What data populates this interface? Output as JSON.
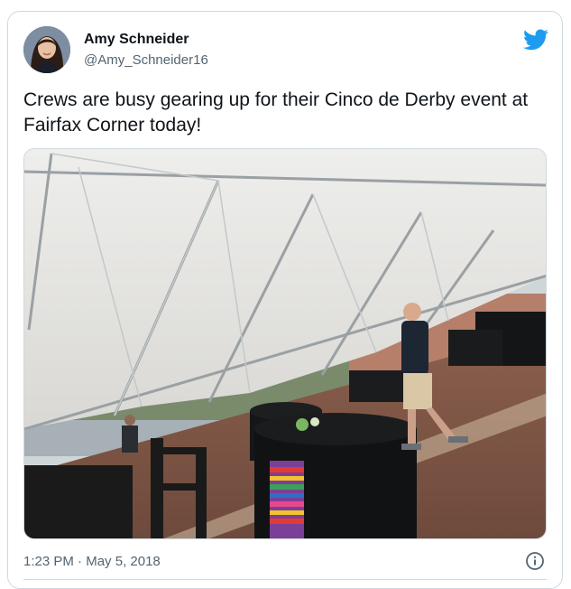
{
  "author": {
    "name": "Amy Schneider",
    "handle": "@Amy_Schneider16",
    "avatar_icon": "profile-photo"
  },
  "tweet": {
    "text": "Crews are busy gearing up for their Cinco de Derby event at Fairfax Corner today!",
    "image_icon": "photo-tent-event-setup"
  },
  "meta": {
    "time": "1:23 PM",
    "separator": "·",
    "date": "May 5, 2018"
  },
  "icons": {
    "brand": "twitter-bird-icon",
    "info": "info-icon"
  },
  "colors": {
    "brand_blue": "#1d9bf0",
    "secondary_text": "#536471",
    "border": "#cfd9de"
  }
}
